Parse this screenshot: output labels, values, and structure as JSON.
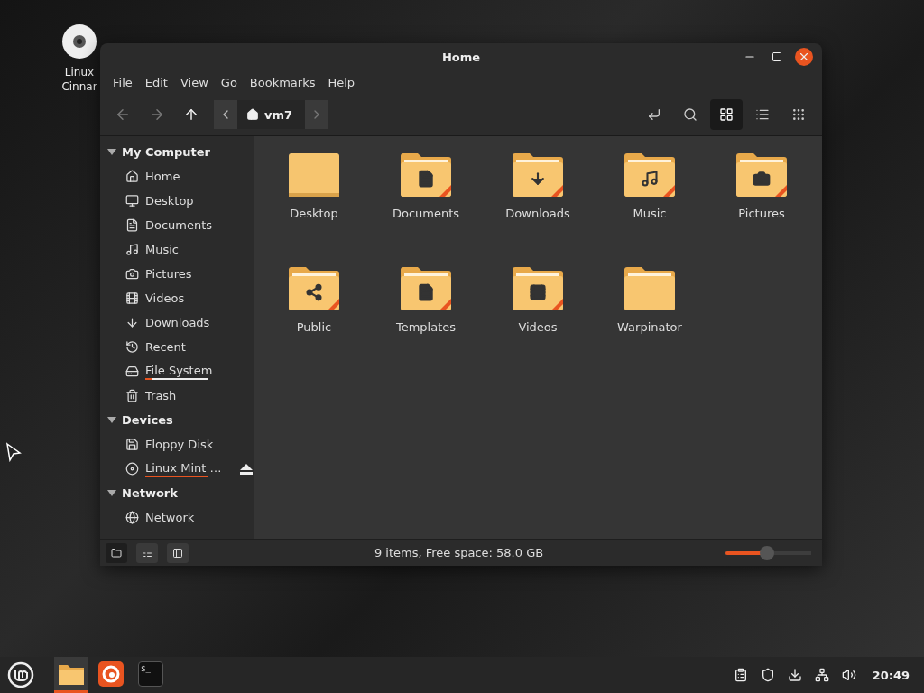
{
  "desktop_icons": [
    {
      "label": "Linux Cinnar",
      "kind": "disc"
    }
  ],
  "window": {
    "title": "Home"
  },
  "menu": [
    "File",
    "Edit",
    "View",
    "Go",
    "Bookmarks",
    "Help"
  ],
  "nav": [
    {
      "kind": "back",
      "disabled": true
    },
    {
      "kind": "forward",
      "disabled": true
    },
    {
      "kind": "up",
      "disabled": false
    }
  ],
  "path_bar": {
    "segments": [
      {
        "label": "vm7",
        "kind": "home"
      }
    ]
  },
  "view_buttons": [
    {
      "kind": "icons",
      "selected": true
    },
    {
      "kind": "list",
      "selected": false
    },
    {
      "kind": "compact",
      "selected": false
    }
  ],
  "sidebar": {
    "sections": [
      {
        "title": "My Computer",
        "expanded": true,
        "items": [
          {
            "label": "Home",
            "kind": "home"
          },
          {
            "label": "Desktop",
            "kind": "desktop"
          },
          {
            "label": "Documents",
            "kind": "document"
          },
          {
            "label": "Music",
            "kind": "music"
          },
          {
            "label": "Pictures",
            "kind": "camera"
          },
          {
            "label": "Videos",
            "kind": "film"
          },
          {
            "label": "Downloads",
            "kind": "download"
          },
          {
            "label": "Recent",
            "kind": "recent"
          },
          {
            "label": "File System",
            "kind": "drive",
            "level": 0.12
          },
          {
            "label": "Trash",
            "kind": "trash"
          }
        ]
      },
      {
        "title": "Devices",
        "expanded": true,
        "items": [
          {
            "label": "Floppy Disk",
            "kind": "floppy"
          },
          {
            "label": "Linux Mint …",
            "kind": "disc",
            "level": 1,
            "eject": true
          }
        ]
      },
      {
        "title": "Network",
        "expanded": true,
        "items": [
          {
            "label": "Network",
            "kind": "globe"
          }
        ]
      }
    ]
  },
  "files": [
    {
      "label": "Desktop",
      "kind": "desktop"
    },
    {
      "label": "Documents",
      "kind": "document"
    },
    {
      "label": "Downloads",
      "kind": "download"
    },
    {
      "label": "Music",
      "kind": "music"
    },
    {
      "label": "Pictures",
      "kind": "camera"
    },
    {
      "label": "Public",
      "kind": "share"
    },
    {
      "label": "Templates",
      "kind": "template"
    },
    {
      "label": "Videos",
      "kind": "film"
    },
    {
      "label": "Warpinator",
      "kind": "plain"
    }
  ],
  "bottom_buttons": [
    {
      "kind": "places",
      "selected": true
    },
    {
      "kind": "tree",
      "selected": false
    },
    {
      "kind": "hide",
      "selected": false
    }
  ],
  "status_bar": {
    "text": "9 items, Free space: 58.0 GB",
    "zoom": {
      "level": 0.48
    }
  },
  "taskbar": {
    "apps": [
      {
        "kind": "files",
        "active": true
      },
      {
        "kind": "firefox",
        "active": false
      },
      {
        "kind": "terminal",
        "active": false,
        "glyph": "$_"
      }
    ],
    "tray": [
      {
        "kind": "clipboard"
      },
      {
        "kind": "shield"
      },
      {
        "kind": "updates"
      },
      {
        "kind": "network"
      },
      {
        "kind": "volume"
      }
    ],
    "clock": "20:49"
  }
}
